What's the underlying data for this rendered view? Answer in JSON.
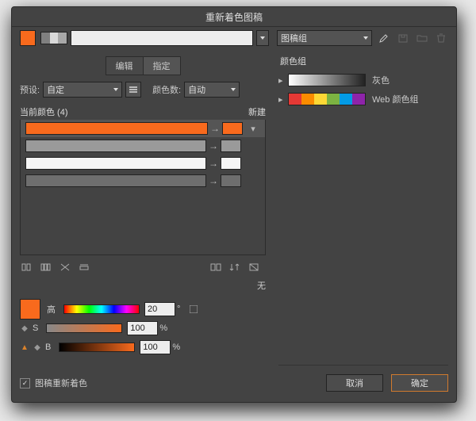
{
  "window": {
    "title": "重新着色图稿"
  },
  "topbar": {
    "artwork_field": "",
    "group_dropdown": "图稿组"
  },
  "tabs": {
    "edit": "编辑",
    "assign": "指定"
  },
  "preset": {
    "label": "预设:",
    "value": "自定",
    "colors_label": "颜色数:",
    "colors_value": "自动"
  },
  "list": {
    "header_left": "当前颜色 (4)",
    "header_right": "新建",
    "rows": [
      {
        "bar": "#f86a1d",
        "target": "#f86a1d",
        "selected": true
      },
      {
        "bar": "#9a9a9a",
        "target": "#9a9a9a",
        "selected": false
      },
      {
        "bar": "#f5f5f5",
        "target": "#f5f5f5",
        "selected": false
      },
      {
        "bar": "#6e6e6e",
        "target": "#6e6e6e",
        "selected": false
      }
    ]
  },
  "none_label": "无",
  "hsb": {
    "h_label": "高",
    "h_value": "20",
    "h_suffix": "°",
    "s_label": "S",
    "s_value": "100",
    "s_suffix": "%",
    "b_label": "B",
    "b_value": "100",
    "b_suffix": "%"
  },
  "groups": {
    "title": "颜色组",
    "items": [
      {
        "label": "灰色",
        "kind": "grey"
      },
      {
        "label": "Web 颜色组",
        "kind": "web"
      }
    ],
    "web_colors": [
      "#e53935",
      "#fb8c00",
      "#fdd835",
      "#7cb342",
      "#039be5",
      "#8e24aa"
    ]
  },
  "footer": {
    "checkbox_label": "图稿重新着色",
    "checked": true,
    "cancel": "取消",
    "ok": "确定"
  },
  "topswatches": [
    "#808080",
    "#d9d9d9",
    "#a8a8a8"
  ]
}
